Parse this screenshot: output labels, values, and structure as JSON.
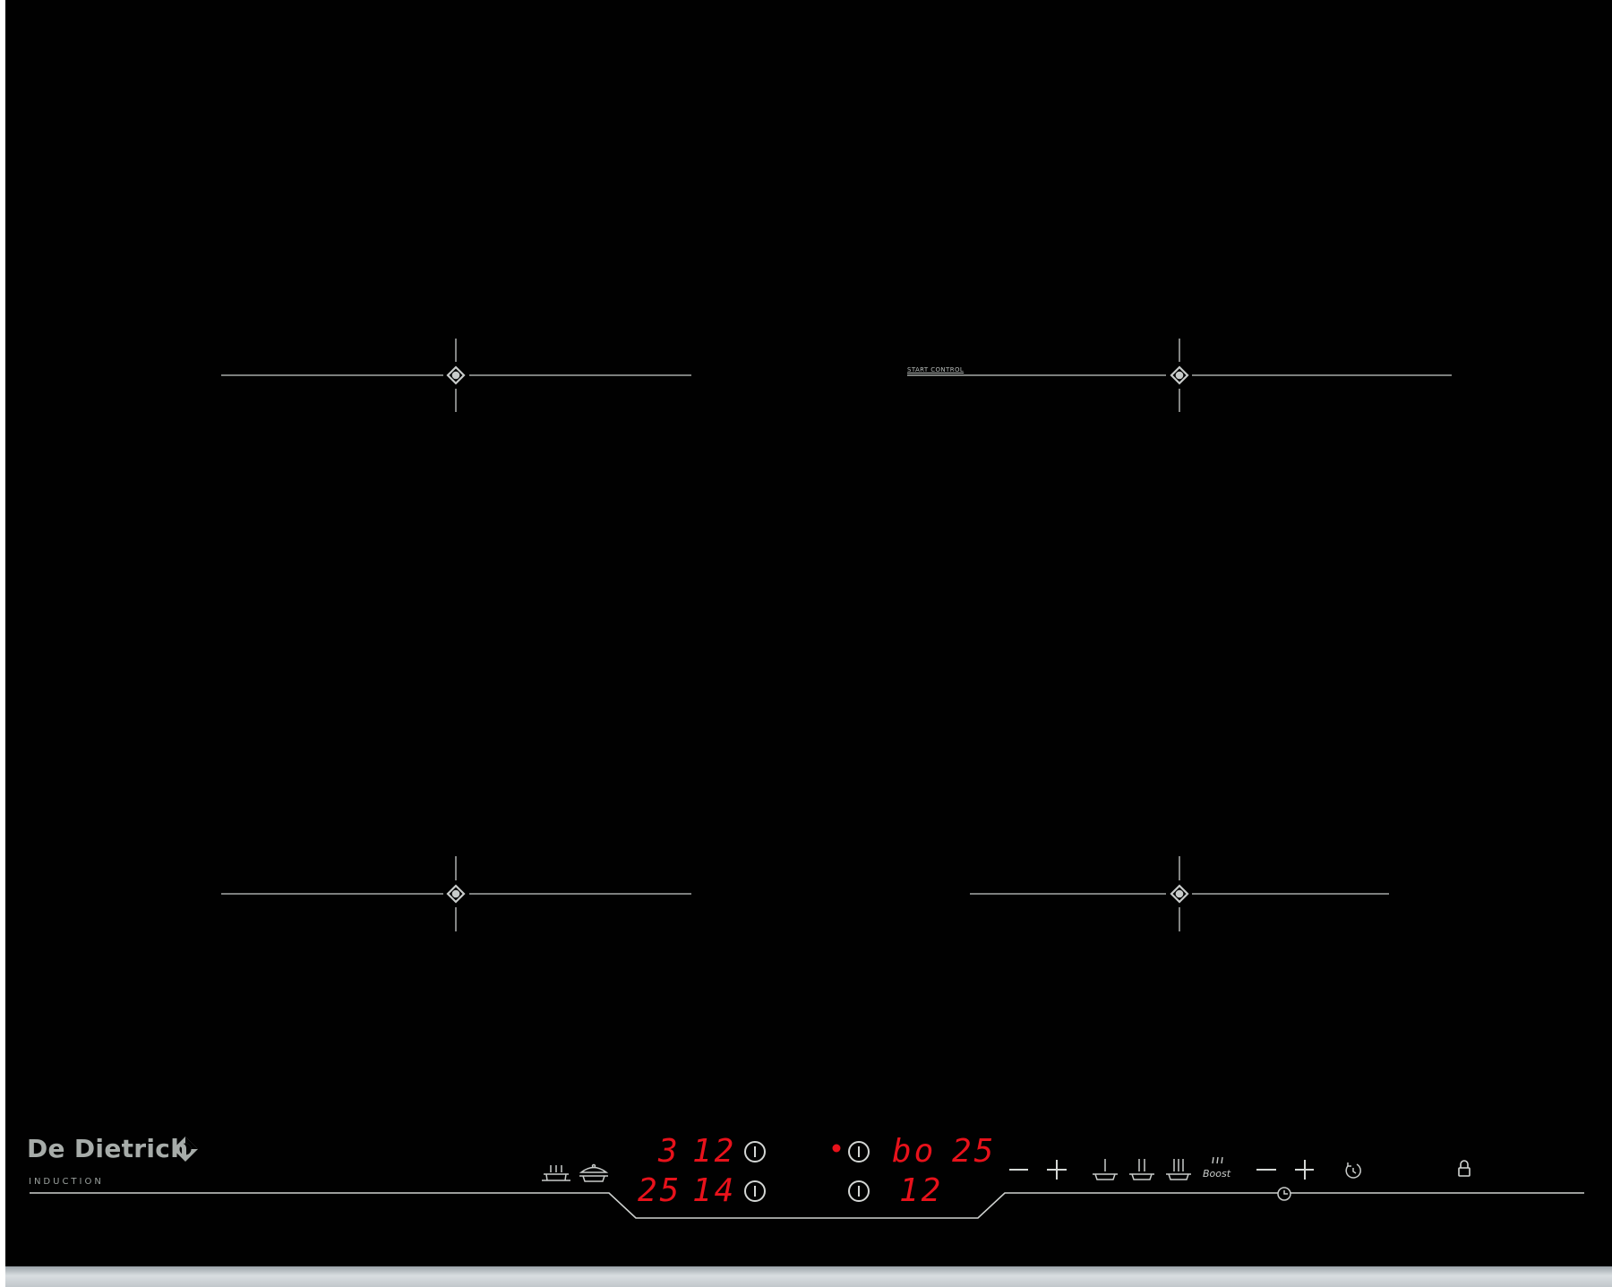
{
  "brand": {
    "name": "De Dietrich",
    "subtitle": "INDUCTION"
  },
  "zone_labels": {
    "start_control": "START CONTROL"
  },
  "displays": {
    "top_left_a": "3",
    "top_left_b": "12",
    "bottom_left_a": "25",
    "bottom_left_b": "14",
    "top_right_a": "bo",
    "top_right_b": "25",
    "bottom_right": "12"
  },
  "controls": {
    "boost_label": "Boost"
  },
  "colors": {
    "glass": "#010101",
    "markings": "#d4d7d5",
    "display_red": "#e8121b",
    "frame_steel": "#c1c7cb"
  },
  "icons": [
    "zone-marker-icon",
    "keep-warm-pan-icon",
    "pan-lid-icon",
    "power-icon",
    "minus-icon",
    "plus-icon",
    "simmer-pan-icon",
    "cook-pan-icon",
    "boil-pan-icon",
    "boost-icon",
    "timer-icon",
    "clock-icon",
    "lock-icon"
  ]
}
